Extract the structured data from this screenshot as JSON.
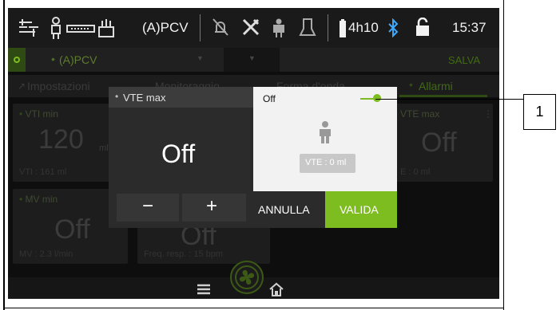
{
  "status_bar": {
    "mode": "(A)PCV",
    "battery": "4h10",
    "time": "15:37",
    "icons": [
      "ventilator-icon",
      "patient-icon",
      "circuit-icon",
      "alarm-off-icon",
      "tools-icon",
      "patient-type-icon",
      "humidifier-icon",
      "battery-icon",
      "bluetooth-icon",
      "lock-open-icon"
    ]
  },
  "mode_bar": {
    "mode_label": "(A)PCV",
    "save": "SALVA"
  },
  "tabs": [
    {
      "label": "Impostazioni"
    },
    {
      "label": "Monitoraggio"
    },
    {
      "label": "Forma d'onda"
    },
    {
      "label": "Allarmi"
    }
  ],
  "tiles": {
    "vti_min": {
      "title": "VTI min",
      "value": "120",
      "unit": "ml",
      "sub": "VTI : 161 ml"
    },
    "vte_max": {
      "title": "VTE max",
      "value": "Off",
      "sub": "E : 0 ml"
    },
    "mv_min": {
      "title": "MV min",
      "value": "Off",
      "sub": "MV : 2.3 l/min"
    },
    "freq": {
      "title": "",
      "value": "Off",
      "sub": "Freq. resp. : 15 bpm"
    }
  },
  "popup": {
    "title": "VTE max",
    "value": "Off",
    "minus": "−",
    "plus": "+",
    "right_title": "Off",
    "readout": "VTE : 0 ml",
    "cancel": "ANNULLA",
    "confirm": "VALIDA",
    "slider_fraction": 1.0
  },
  "annotation": {
    "number": "1"
  },
  "colors": {
    "accent_green": "#7dbd1f",
    "background": "#0e0e0e",
    "popup_white": "#f2f2f2"
  }
}
